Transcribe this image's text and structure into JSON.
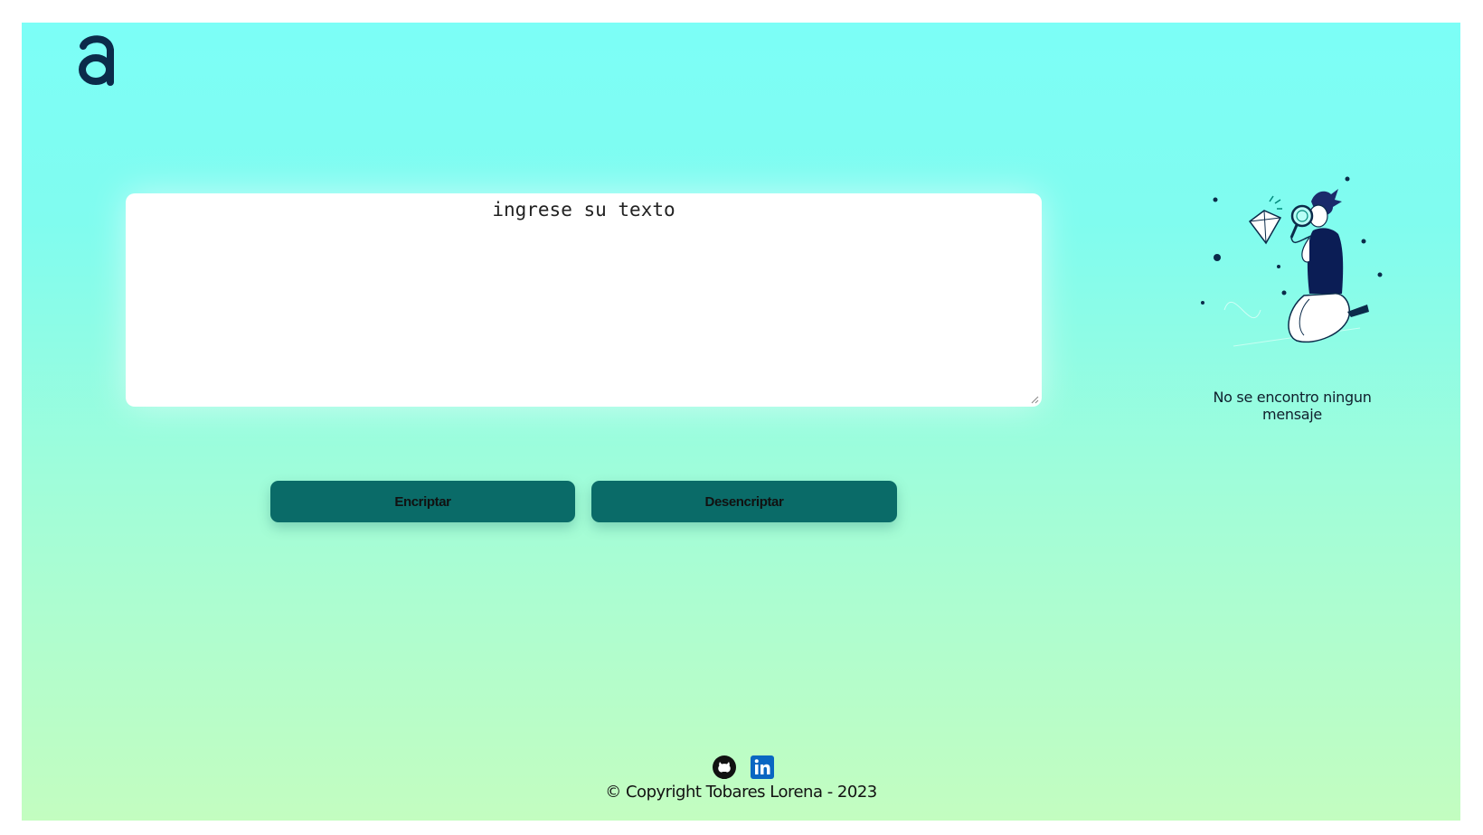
{
  "header": {
    "logo_icon": "alura-a-logo-icon"
  },
  "input": {
    "placeholder": "ingrese su texto",
    "value": ""
  },
  "buttons": {
    "encrypt_label": "Encriptar",
    "decrypt_label": "Desencriptar"
  },
  "output": {
    "illustration": "person-with-magnifier-and-diamond-illustration",
    "empty_message": "No se encontro ningun mensaje"
  },
  "footer": {
    "social_icons": [
      "github-icon",
      "linkedin-icon"
    ],
    "copyright": "© Copyright Tobares Lorena - 2023"
  },
  "colors": {
    "background_top": "#7cfef7",
    "background_bottom": "#c3fdc0",
    "button_bg": "#0a6b68",
    "logo": "#0b2b4a",
    "linkedin": "#0a66c2"
  }
}
